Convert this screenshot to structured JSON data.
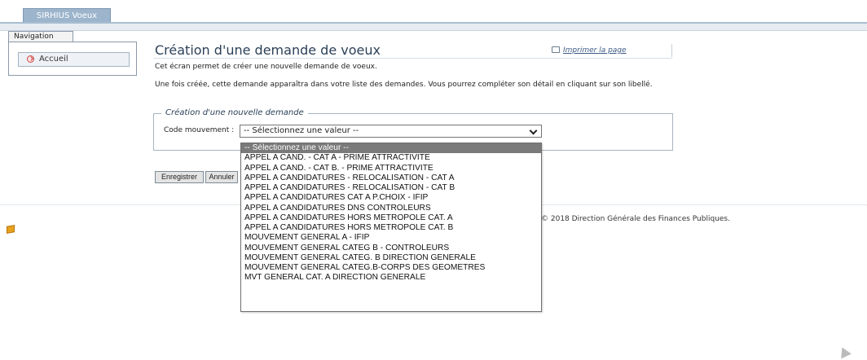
{
  "app": {
    "tab_label": "SIRHIUS Voeux"
  },
  "navigation": {
    "title": "Navigation",
    "items": [
      {
        "label": "Accueil"
      }
    ]
  },
  "page": {
    "title": "Création d'une demande de voeux",
    "print_label": "Imprimer la page",
    "description_1": "Cet écran permet de créer une nouvelle demande de voeux.",
    "description_2": "Une fois créée, cette demande apparaîtra dans votre liste des demandes. Vous pourrez compléter son détail en cliquant sur son libellé."
  },
  "form": {
    "legend": "Création d'une nouvelle demande",
    "code_label": "Code mouvement :",
    "select_value": "-- Sélectionnez une valeur --",
    "options": [
      "-- Sélectionnez une valeur --",
      "APPEL A CAND. - CAT A - PRIME ATTRACTIVITE",
      "APPEL A CAND. - CAT B. - PRIME ATTRACTIVITE",
      "APPEL A CANDIDATURES - RELOCALISATION - CAT A",
      "APPEL A CANDIDATURES - RELOCALISATION - CAT B",
      "APPEL A CANDIDATURES CAT A P.CHOIX - IFIP",
      "APPEL A CANDIDATURES DNS CONTROLEURS",
      "APPEL A CANDIDATURES HORS METROPOLE CAT. A",
      "APPEL A CANDIDATURES HORS METROPOLE CAT. B",
      "MOUVEMENT GENERAL A - IFIP",
      "MOUVEMENT GENERAL CATEG B - CONTROLEURS",
      "MOUVEMENT GENERAL CATEG. B DIRECTION GENERALE",
      "MOUVEMENT GENERAL CATEG.B-CORPS DES GEOMETRES",
      "MVT GENERAL CAT. A DIRECTION GENERALE"
    ],
    "save_label": "Enregistrer",
    "cancel_label": "Annuler"
  },
  "footer": {
    "text": "© 2018 Direction Générale des Finances Publiques."
  }
}
